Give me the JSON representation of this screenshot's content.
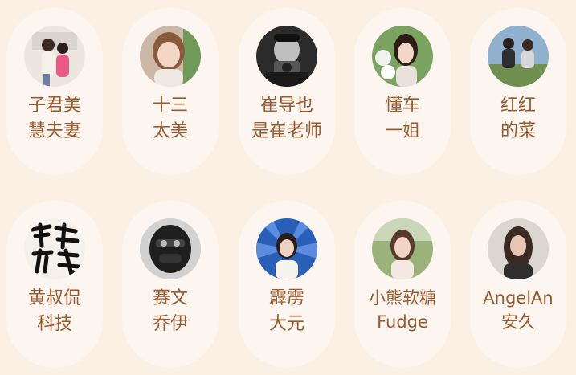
{
  "creators": [
    {
      "line1": "子君美",
      "line2": "慧夫妻",
      "avatar_icon": "couple-photo-avatar",
      "bg": "#e9e4de"
    },
    {
      "line1": "十三",
      "line2": "太美",
      "avatar_icon": "woman-photo-avatar",
      "bg": "#c9b6a6"
    },
    {
      "line1": "崔导也",
      "line2": "是崔老师",
      "avatar_icon": "man-camera-photo-avatar",
      "bg": "#3a3a3a"
    },
    {
      "line1": "懂车",
      "line2": "一姐",
      "avatar_icon": "woman-flowers-photo-avatar",
      "bg": "#6f9a57"
    },
    {
      "line1": "红红",
      "line2": "的菜",
      "avatar_icon": "couple-outdoor-photo-avatar",
      "bg": "#7aa1c4"
    },
    {
      "line1": "黄叔侃",
      "line2": "科技",
      "avatar_icon": "calligraphy-logo-avatar",
      "bg": "#f2f0ec"
    },
    {
      "line1": "赛文",
      "line2": "乔伊",
      "avatar_icon": "helmet-man-photo-avatar",
      "bg": "#cfcfcf"
    },
    {
      "line1": "霹雳",
      "line2": "大元",
      "avatar_icon": "woman-blue-burst-avatar",
      "bg": "#2a5fb8"
    },
    {
      "line1": "小熊软糖",
      "line2": "Fudge",
      "avatar_icon": "woman-garden-photo-avatar",
      "bg": "#9fb57d"
    },
    {
      "line1": "AngelAn",
      "line2": "安久",
      "avatar_icon": "woman-portrait-photo-avatar",
      "bg": "#d8d2cc"
    }
  ]
}
